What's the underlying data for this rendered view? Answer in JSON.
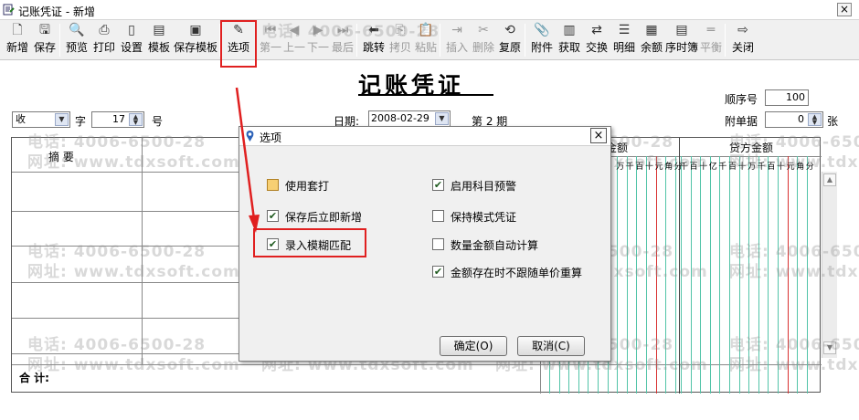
{
  "window": {
    "title": "记账凭证 - 新增",
    "close": "×"
  },
  "toolbar": {
    "items": [
      {
        "label": "新增",
        "icon": "new-icon",
        "glyph": "🗋",
        "enabled": true
      },
      {
        "label": "保存",
        "icon": "save-icon",
        "glyph": "🖫",
        "enabled": true
      },
      {
        "label": "预览",
        "icon": "preview-icon",
        "glyph": "🔍",
        "enabled": true
      },
      {
        "label": "打印",
        "icon": "print-icon",
        "glyph": "⎙",
        "enabled": true
      },
      {
        "label": "设置",
        "icon": "settings-icon",
        "glyph": "▯",
        "enabled": true
      },
      {
        "label": "模板",
        "icon": "template-icon",
        "glyph": "▤",
        "enabled": true
      },
      {
        "label": "保存模板",
        "icon": "save-template-icon",
        "glyph": "▣",
        "enabled": true
      },
      {
        "label": "选项",
        "icon": "options-icon",
        "glyph": "✎",
        "enabled": true
      },
      {
        "label": "第一",
        "icon": "first-icon",
        "glyph": "⏮",
        "enabled": false
      },
      {
        "label": "上一",
        "icon": "prev-icon",
        "glyph": "◀",
        "enabled": false
      },
      {
        "label": "下一",
        "icon": "next-icon",
        "glyph": "▶",
        "enabled": false
      },
      {
        "label": "最后",
        "icon": "last-icon",
        "glyph": "⏭",
        "enabled": false
      },
      {
        "label": "跳转",
        "icon": "jump-icon",
        "glyph": "⬅",
        "enabled": true
      },
      {
        "label": "拷贝",
        "icon": "copy-icon",
        "glyph": "⎘",
        "enabled": false
      },
      {
        "label": "粘贴",
        "icon": "paste-icon",
        "glyph": "📋",
        "enabled": false
      },
      {
        "label": "插入",
        "icon": "insert-icon",
        "glyph": "⇥",
        "enabled": false
      },
      {
        "label": "删除",
        "icon": "delete-icon",
        "glyph": "✂",
        "enabled": false
      },
      {
        "label": "复原",
        "icon": "restore-icon",
        "glyph": "⟲",
        "enabled": true
      },
      {
        "label": "附件",
        "icon": "attachment-icon",
        "glyph": "📎",
        "enabled": true
      },
      {
        "label": "获取",
        "icon": "fetch-icon",
        "glyph": "▥",
        "enabled": true
      },
      {
        "label": "交换",
        "icon": "swap-icon",
        "glyph": "⇄",
        "enabled": true
      },
      {
        "label": "明细",
        "icon": "detail-icon",
        "glyph": "☰",
        "enabled": true
      },
      {
        "label": "余额",
        "icon": "balance-icon",
        "glyph": "▦",
        "enabled": true
      },
      {
        "label": "序时簿",
        "icon": "journal-icon",
        "glyph": "▤",
        "enabled": true
      },
      {
        "label": "平衡",
        "icon": "balance-check-icon",
        "glyph": "═",
        "enabled": false
      },
      {
        "label": "关闭",
        "icon": "exit-icon",
        "glyph": "⇨",
        "enabled": true
      }
    ]
  },
  "voucher": {
    "title": "记账凭证",
    "seq_label": "顺序号",
    "seq_value": "100",
    "voucher_word": "收",
    "word_label": "字",
    "number": "17",
    "number_label": "号",
    "date_label": "日期:",
    "date_value": "2008-02-29",
    "period_label": "第 2 期",
    "attach_label": "附单据",
    "attach_value": "0",
    "attach_unit": "张",
    "col_summary": "摘  要",
    "col_debit": "金额",
    "col_credit": "贷方金额",
    "digit_units": [
      "千",
      "百",
      "十",
      "亿",
      "千",
      "百",
      "十",
      "万",
      "千",
      "百",
      "十",
      "元",
      "角",
      "分"
    ],
    "total_label": "合  计:"
  },
  "watermark": {
    "phone": "电话: 4006-6500-28",
    "site": "网址: www.tdxsoft.com"
  },
  "dialog": {
    "title": "选项",
    "left_options": [
      {
        "label": "使用套打",
        "checked": false,
        "style": "yellow"
      },
      {
        "label": "保存后立即新增",
        "checked": true,
        "style": "normal"
      },
      {
        "label": "录入模糊匹配",
        "checked": true,
        "style": "normal"
      }
    ],
    "right_options": [
      {
        "label": "启用科目预警",
        "checked": true
      },
      {
        "label": "保持模式凭证",
        "checked": false
      },
      {
        "label": "数量金额自动计算",
        "checked": false
      },
      {
        "label": "金额存在时不跟随单价重算",
        "checked": true
      }
    ],
    "ok_label": "确定(O)",
    "cancel_label": "取消(C)"
  },
  "colors": {
    "highlight": "#e02020",
    "grid_line": "#52c4a8"
  }
}
